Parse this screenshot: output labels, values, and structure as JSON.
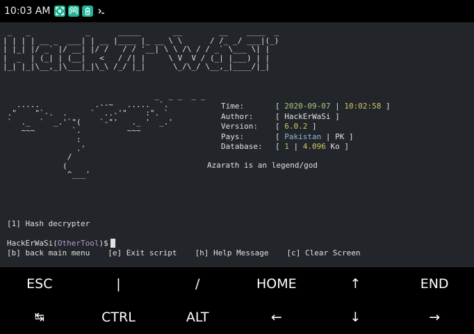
{
  "status_bar": {
    "time": "10:03 AM",
    "icons": [
      "screenshot-icon",
      "hotspot-icon",
      "battery-saver-icon",
      "terminal-icon"
    ]
  },
  "terminal": {
    "banner": " _   _            _      _____       __        __    ____  _ \n| | | | __ _  ___| | __ |____ |_ __ \\ \\      / /_ _/ ___|(_)\n| |_| |/ _` |/ __| |/ /   / / '__| \\ \\ /\\ / / _` \\___ \\| |\n|  _  | (_| | (__|   <   / /| |     \\ V  V / (_| |___) | |\n|_| |_|\\__,_|\\___|_|\\_\\ /_/ |_|      \\_/\\_/ \\__,_|____/|_|",
    "art": "                                 _  _ _  _ _\n   .....            .--~   .....  `.\n .\"    \"`-.  .     `  ..-'\"    :\". `\n `  ._  `  _.'`\"(    `-\"'   ._ '  _.'\n    ~~~        `.          ~~~\n                :\n                .'\n              /\n             (\n              ^___'",
    "info": [
      {
        "label": "Time:",
        "parts": [
          {
            "t": "[ ",
            "c": ""
          },
          {
            "t": "2020-09-07",
            "c": "v-green"
          },
          {
            "t": " | ",
            "c": ""
          },
          {
            "t": "10:02:58",
            "c": "v-yellow"
          },
          {
            "t": " ]",
            "c": ""
          }
        ]
      },
      {
        "label": "Author:",
        "parts": [
          {
            "t": "[ HackErWaSi ]",
            "c": ""
          }
        ]
      },
      {
        "label": "Version:",
        "parts": [
          {
            "t": "[ ",
            "c": ""
          },
          {
            "t": "6.0.2",
            "c": "v-yellow"
          },
          {
            "t": " ]",
            "c": ""
          }
        ]
      },
      {
        "label": "Pays:",
        "parts": [
          {
            "t": "[ ",
            "c": ""
          },
          {
            "t": "Pakistan",
            "c": "v-blue"
          },
          {
            "t": " | PK ]",
            "c": ""
          }
        ]
      },
      {
        "label": "Database:",
        "parts": [
          {
            "t": "[ ",
            "c": ""
          },
          {
            "t": "1",
            "c": "v-green"
          },
          {
            "t": " | ",
            "c": ""
          },
          {
            "t": "4.096",
            "c": "v-yellow"
          },
          {
            "t": " Ko ]",
            "c": ""
          }
        ]
      }
    ],
    "tagline": "Azarath is an legend/god",
    "menu": {
      "hash": "[1] Hash decrypter",
      "back": "[b] back main menu",
      "exit": "[e] Exit script",
      "help": "[h] Help Message",
      "clear": "[c] Clear Screen"
    },
    "prompt": {
      "user": "HackErWaSi(",
      "path": "OtherTool",
      "suffix": ")$"
    }
  },
  "extra_keys": {
    "row1": [
      "ESC",
      "|",
      "/",
      "HOME",
      "↑",
      "END"
    ],
    "row2": [
      "↹",
      "CTRL",
      "ALT",
      "←",
      "↓",
      "→"
    ]
  },
  "colors": {
    "terminal_bg": "#22262a",
    "accent_teal": "#1fb596",
    "prompt_path": "#b79ad1"
  }
}
